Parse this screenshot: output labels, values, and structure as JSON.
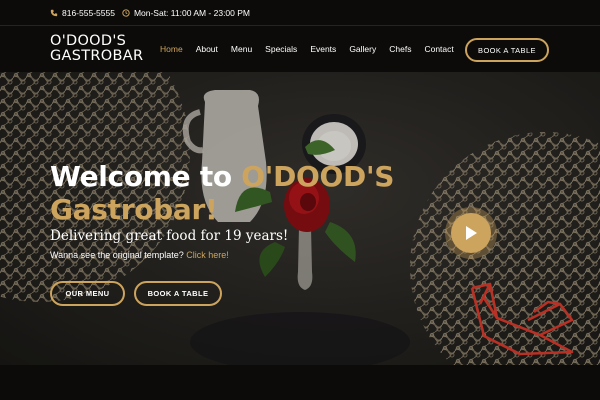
{
  "topbar": {
    "phone": "816-555-5555",
    "hours": "Mon-Sat: 11:00 AM - 23:00 PM",
    "phone_icon": "phone-icon",
    "clock_icon": "clock-icon"
  },
  "header": {
    "logo_line1": "O'DOOD'S",
    "logo_line2": "GASTROBAR",
    "nav": [
      {
        "label": "Home",
        "active": true
      },
      {
        "label": "About"
      },
      {
        "label": "Menu"
      },
      {
        "label": "Specials"
      },
      {
        "label": "Events"
      },
      {
        "label": "Gallery"
      },
      {
        "label": "Chefs"
      },
      {
        "label": "Contact"
      }
    ],
    "book_button": "BOOK A TABLE"
  },
  "hero": {
    "title_white": "Welcome to ",
    "title_gold_1": "O'DOOD'S",
    "title_gold_2": "Gastrobar!",
    "subtitle": "Delivering great food for 19 years!",
    "note": "Wanna see the original template? ",
    "note_link": "Click here!",
    "menu_button": "OUR MENU",
    "book_button": "BOOK A TABLE",
    "play_icon": "play-icon"
  },
  "colors": {
    "accent": "#cda45e",
    "background": "#0c0b09",
    "logo_mark": "#e23b2e"
  }
}
